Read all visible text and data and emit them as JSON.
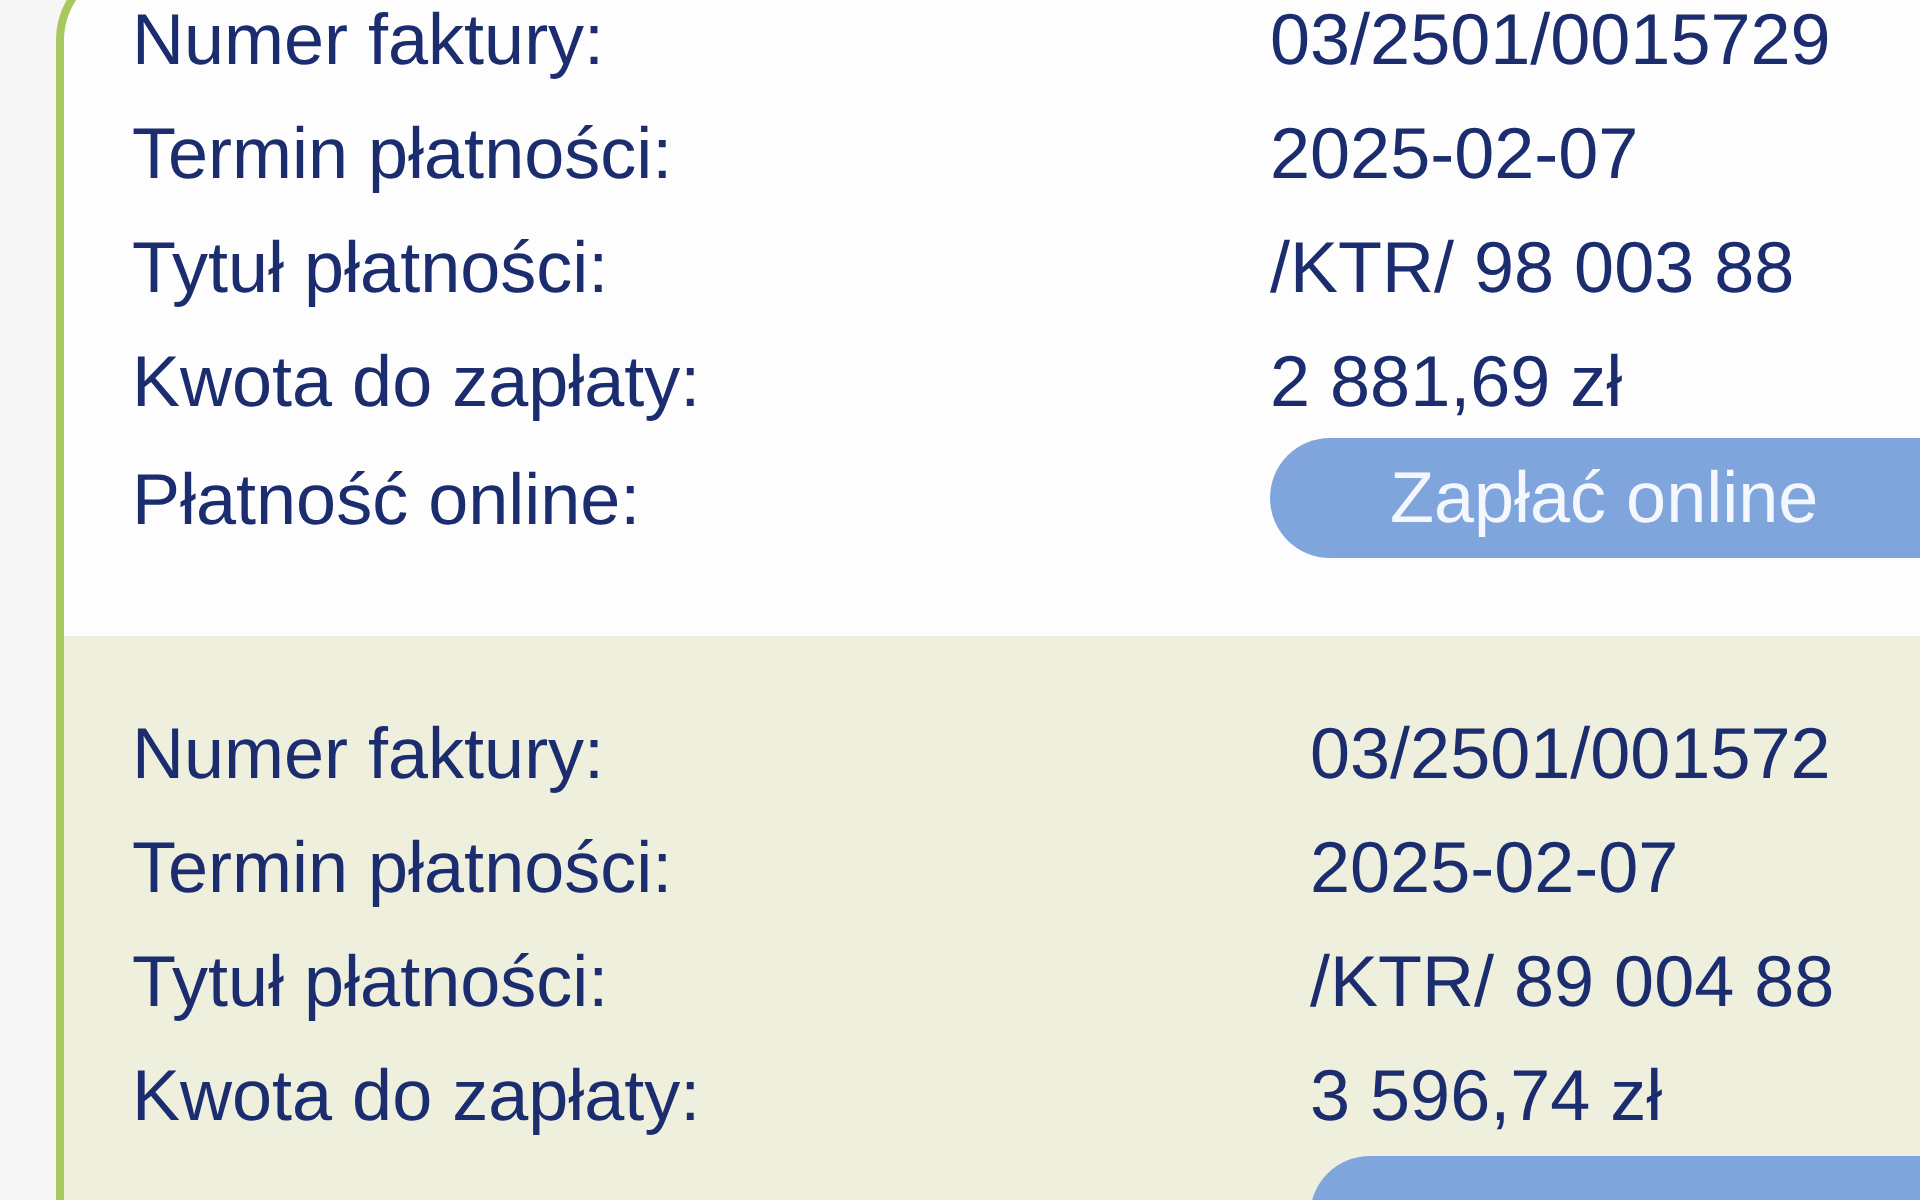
{
  "invoices": [
    {
      "rows": [
        {
          "kind": "text",
          "label": "Numer faktury:",
          "value": "03/2501/0015729"
        },
        {
          "kind": "text",
          "label": "Termin płatności:",
          "value": "2025-02-07"
        },
        {
          "kind": "text",
          "label": "Tytuł płatności:",
          "value": "/KTR/ 98 003 88"
        },
        {
          "kind": "text",
          "label": "Kwota do zapłaty:",
          "value": "2 881,69 zł"
        },
        {
          "kind": "button",
          "label": "Płatność online:",
          "value": "Zapłać online"
        }
      ]
    },
    {
      "rows": [
        {
          "kind": "text",
          "label": "Numer faktury:",
          "value": "03/2501/001572"
        },
        {
          "kind": "text",
          "label": "Termin płatności:",
          "value": "2025-02-07"
        },
        {
          "kind": "text",
          "label": "Tytuł płatności:",
          "value": "/KTR/ 89 004 88"
        },
        {
          "kind": "text",
          "label": "Kwota do zapłaty:",
          "value": "3 596,74 zł"
        },
        {
          "kind": "button_edge"
        }
      ]
    }
  ]
}
